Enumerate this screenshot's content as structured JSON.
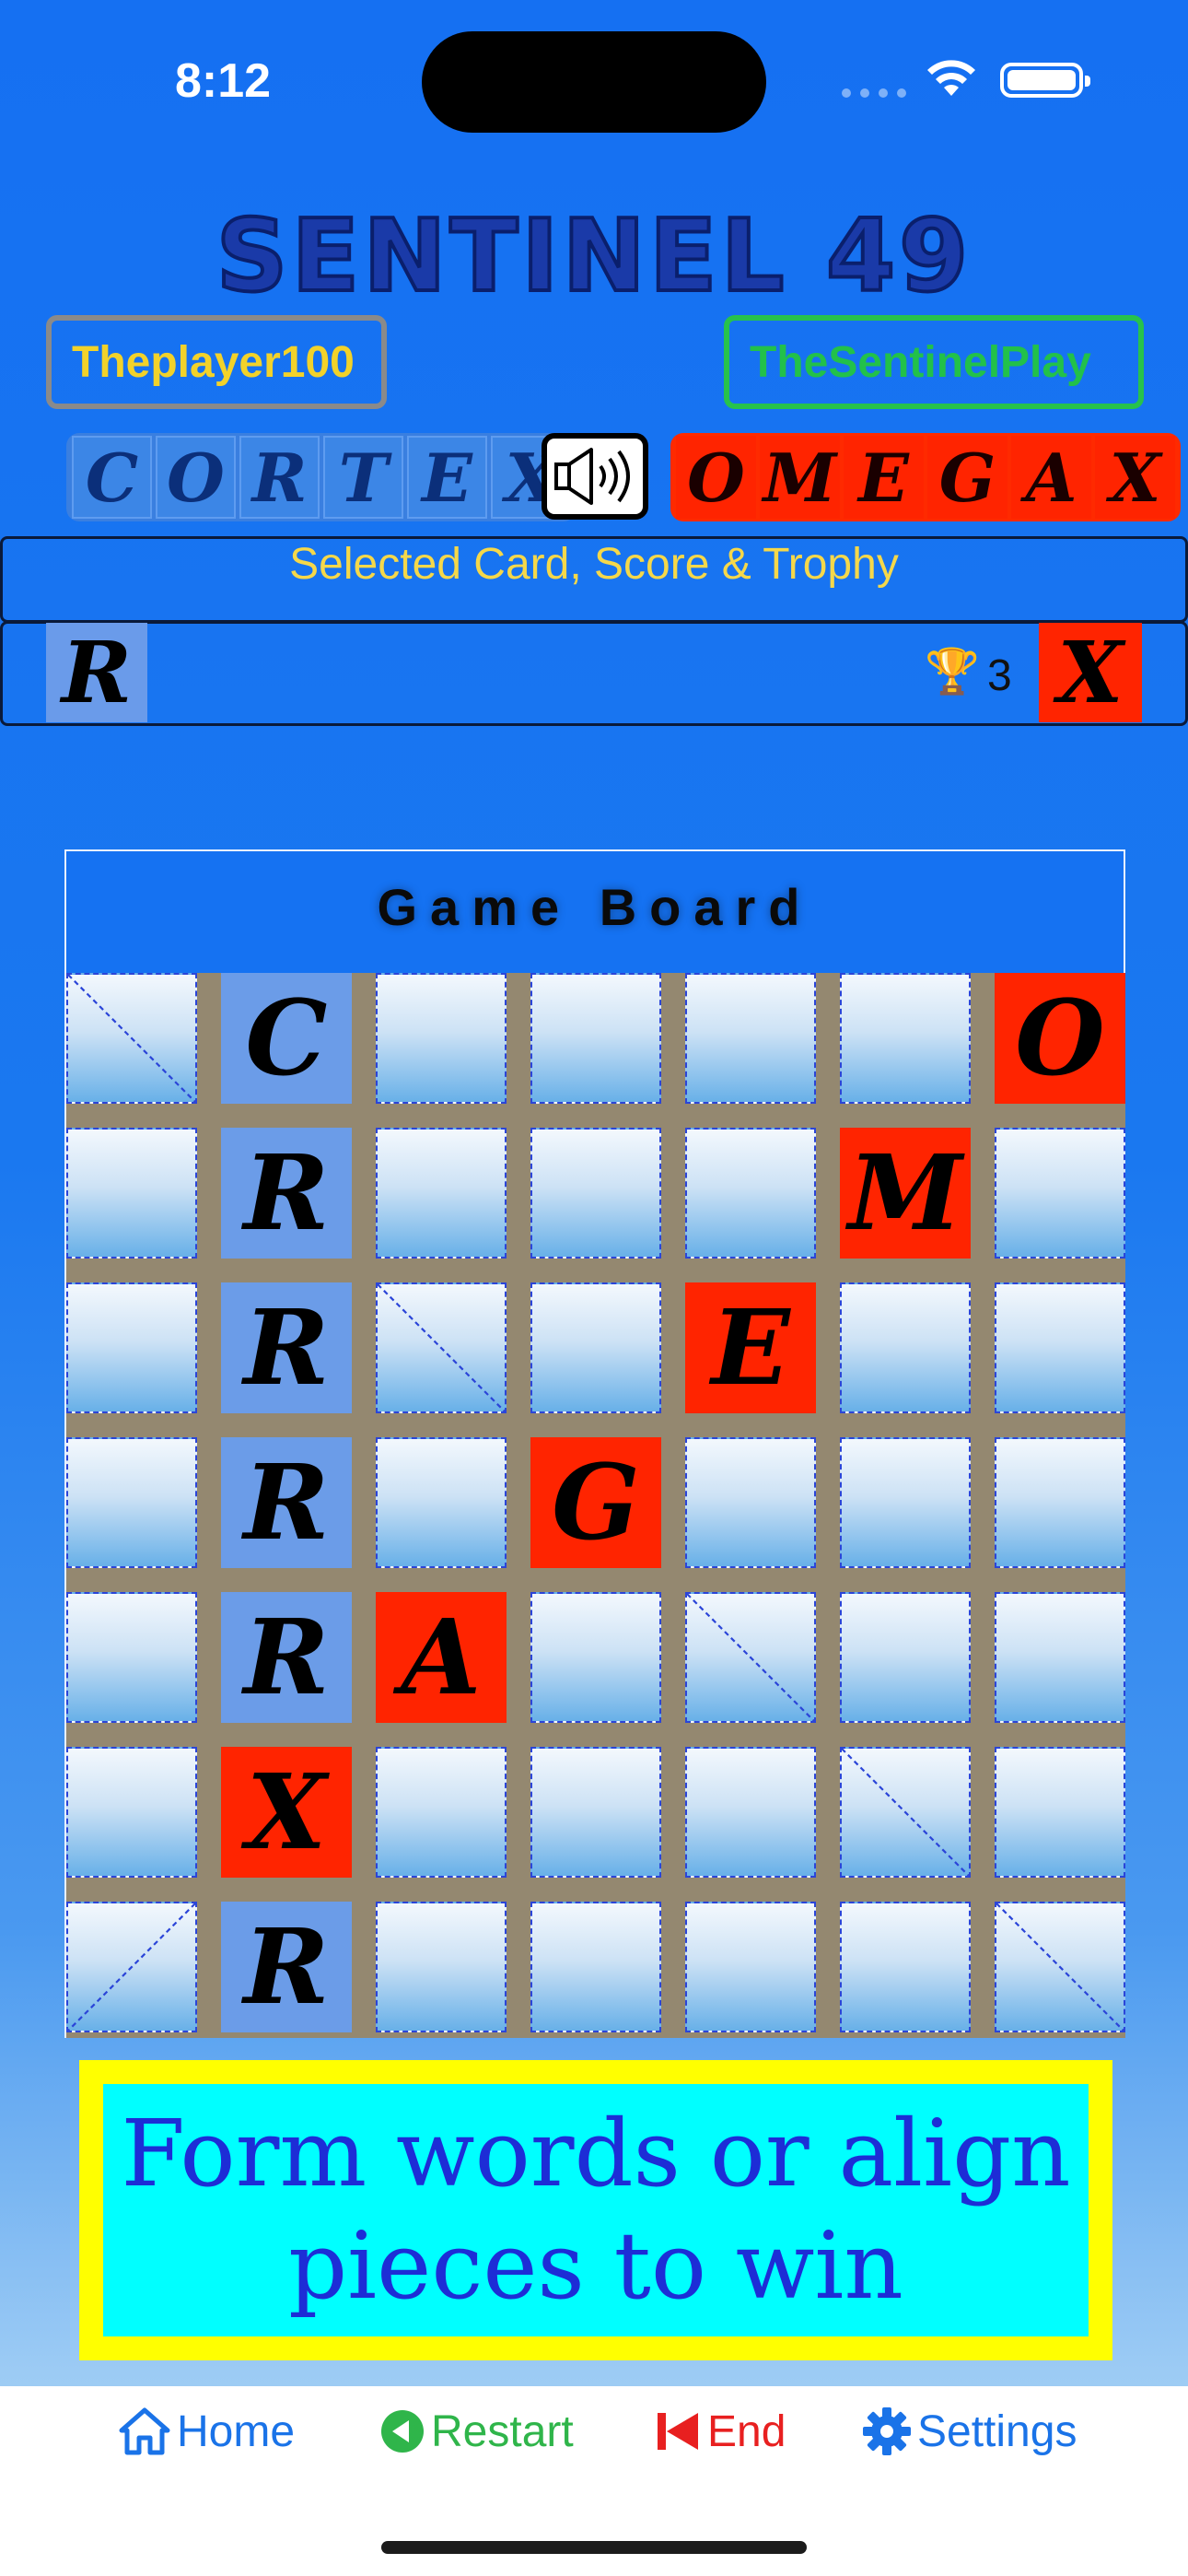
{
  "status_bar": {
    "time": "8:12"
  },
  "title": "SENTINEL 49",
  "players": {
    "left_name": "Theplayer100",
    "right_name": "TheSentinelPlay"
  },
  "words": {
    "left": [
      "C",
      "O",
      "R",
      "T",
      "E",
      "X"
    ],
    "right": [
      "O",
      "M",
      "E",
      "G",
      "A",
      "X"
    ]
  },
  "sound_icon": "speaker-icon",
  "score_panel": {
    "caption": "Selected Card, Score & Trophy",
    "selected_card": "R",
    "trophy_icon": "🏆",
    "score": "3",
    "opponent_card": "X"
  },
  "board": {
    "title": "Game Board",
    "rows": [
      [
        {
          "t": "",
          "c": "empty",
          "d": "tl-br"
        },
        {
          "t": "C",
          "c": "blue"
        },
        {
          "t": "",
          "c": "empty"
        },
        {
          "t": "",
          "c": "empty"
        },
        {
          "t": "",
          "c": "empty"
        },
        {
          "t": "",
          "c": "empty"
        },
        {
          "t": "O",
          "c": "red"
        }
      ],
      [
        {
          "t": "",
          "c": "empty"
        },
        {
          "t": "R",
          "c": "blue"
        },
        {
          "t": "",
          "c": "empty"
        },
        {
          "t": "",
          "c": "empty"
        },
        {
          "t": "",
          "c": "empty"
        },
        {
          "t": "M",
          "c": "red"
        },
        {
          "t": "",
          "c": "empty"
        }
      ],
      [
        {
          "t": "",
          "c": "empty"
        },
        {
          "t": "R",
          "c": "blue"
        },
        {
          "t": "",
          "c": "empty",
          "d": "tl-br"
        },
        {
          "t": "",
          "c": "empty"
        },
        {
          "t": "E",
          "c": "red"
        },
        {
          "t": "",
          "c": "empty"
        },
        {
          "t": "",
          "c": "empty"
        }
      ],
      [
        {
          "t": "",
          "c": "empty"
        },
        {
          "t": "R",
          "c": "blue"
        },
        {
          "t": "",
          "c": "empty"
        },
        {
          "t": "G",
          "c": "red"
        },
        {
          "t": "",
          "c": "empty"
        },
        {
          "t": "",
          "c": "empty"
        },
        {
          "t": "",
          "c": "empty"
        }
      ],
      [
        {
          "t": "",
          "c": "empty"
        },
        {
          "t": "R",
          "c": "blue"
        },
        {
          "t": "A",
          "c": "red"
        },
        {
          "t": "",
          "c": "empty"
        },
        {
          "t": "",
          "c": "empty",
          "d": "tl-br"
        },
        {
          "t": "",
          "c": "empty"
        },
        {
          "t": "",
          "c": "empty"
        }
      ],
      [
        {
          "t": "",
          "c": "empty"
        },
        {
          "t": "X",
          "c": "red"
        },
        {
          "t": "",
          "c": "empty"
        },
        {
          "t": "",
          "c": "empty"
        },
        {
          "t": "",
          "c": "empty"
        },
        {
          "t": "",
          "c": "empty",
          "d": "tl-br"
        },
        {
          "t": "",
          "c": "empty"
        }
      ],
      [
        {
          "t": "",
          "c": "empty",
          "d": "tr-bl"
        },
        {
          "t": "R",
          "c": "blue"
        },
        {
          "t": "",
          "c": "empty"
        },
        {
          "t": "",
          "c": "empty"
        },
        {
          "t": "",
          "c": "empty"
        },
        {
          "t": "",
          "c": "empty"
        },
        {
          "t": "",
          "c": "empty",
          "d": "tl-br"
        }
      ]
    ]
  },
  "hint": {
    "line1": "Form words or align",
    "line2": "pieces to win"
  },
  "tabbar": {
    "home": "Home",
    "restart": "Restart",
    "end": "End",
    "settings": "Settings"
  },
  "colors": {
    "blue_piece": "#6b9ce8",
    "red_piece": "#ff2400",
    "grid": "#948870"
  }
}
